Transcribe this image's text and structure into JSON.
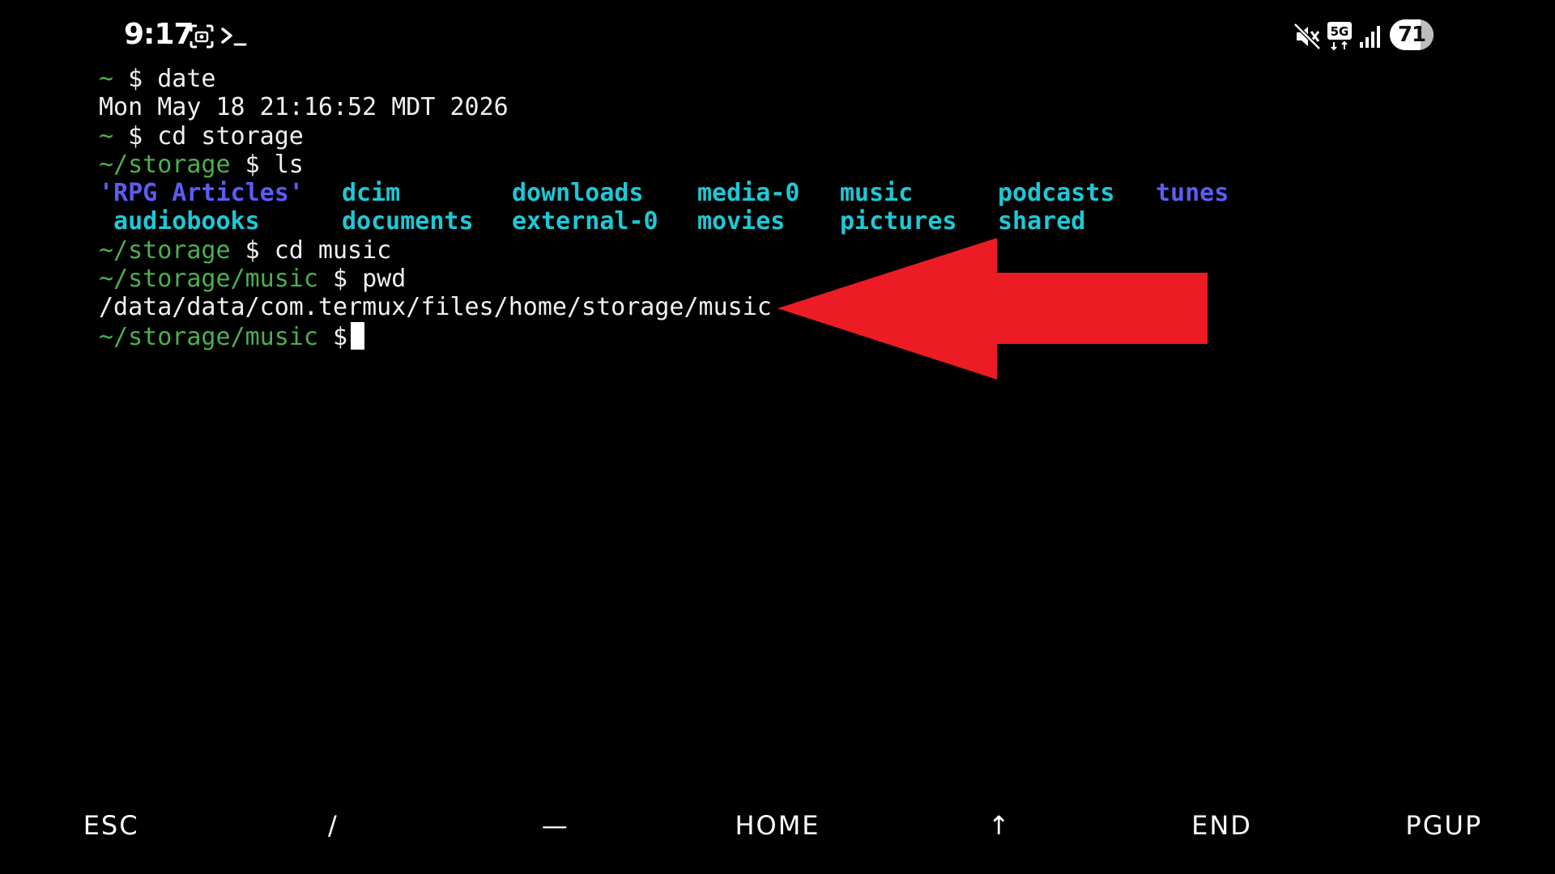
{
  "status_bar": {
    "time": "9:17",
    "left_icons": [
      "screenshot-icon",
      "terminal-icon"
    ],
    "right_icons": [
      "mute-icon",
      "5g-icon",
      "signal-icon"
    ],
    "network_badge": "5G",
    "battery_percent": "71"
  },
  "terminal": {
    "prompt_symbol": "$",
    "lines": [
      {
        "path": "~",
        "command": "date"
      },
      {
        "output": "Mon May 18 21:16:52 MDT 2026"
      },
      {
        "path": "~",
        "command": "cd storage"
      },
      {
        "path": "~/storage",
        "command": "ls"
      },
      {
        "path": "~/storage",
        "command": "cd music"
      },
      {
        "path": "~/storage/music",
        "command": "pwd"
      },
      {
        "output": "/data/data/com.termux/files/home/storage/music"
      },
      {
        "path": "~/storage/music",
        "command": ""
      }
    ],
    "ls_rows": [
      [
        "'RPG Articles'",
        "dcim",
        "downloads",
        "media-0",
        "music",
        "podcasts",
        "tunes"
      ],
      [
        " audiobooks",
        "documents",
        "external-0",
        "movies",
        "pictures",
        "shared"
      ]
    ],
    "colors": {
      "prompt": "#4caf50",
      "directory": "#1ec8d6",
      "symlink": "#5c5cf5"
    }
  },
  "annotation": {
    "type": "arrow",
    "color": "#ed1c24",
    "points_to": "pwd output"
  },
  "extra_keys": [
    "ESC",
    "/",
    "—",
    "HOME",
    "↑",
    "END",
    "PGUP"
  ]
}
